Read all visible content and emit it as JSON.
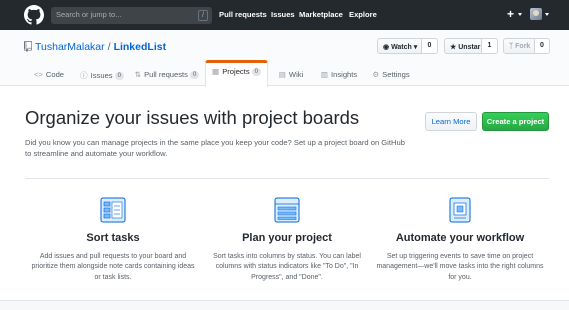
{
  "header": {
    "search_placeholder": "Search or jump to...",
    "search_key": "/",
    "nav": [
      "Pull requests",
      "Issues",
      "Marketplace",
      "Explore"
    ],
    "plus": "+"
  },
  "repo": {
    "owner": "TusharMalakar",
    "separator": "/",
    "name": "LinkedList",
    "watch_label": "Watch",
    "watch_count": "0",
    "unstar_label": "Unstar",
    "star_count": "1",
    "fork_label": "Fork",
    "fork_count": "0"
  },
  "tabs": [
    {
      "label": "Code",
      "icon": "<>",
      "count": null
    },
    {
      "label": "Issues",
      "icon": "ⓘ",
      "count": "0"
    },
    {
      "label": "Pull requests",
      "icon": "⇅",
      "count": "0"
    },
    {
      "label": "Projects",
      "icon": "▦",
      "count": "0",
      "selected": true
    },
    {
      "label": "Wiki",
      "icon": "▤",
      "count": null
    },
    {
      "label": "Insights",
      "icon": "▥",
      "count": null
    },
    {
      "label": "Settings",
      "icon": "⚙",
      "count": null
    }
  ],
  "blankslate": {
    "title": "Organize your issues with project boards",
    "description": "Did you know you can manage projects in the same place you keep your code? Set up a project board on GitHub to streamline and automate your workflow.",
    "learn_more": "Learn More",
    "create_project": "Create a project"
  },
  "features": [
    {
      "title": "Sort tasks",
      "icon": "sort-tasks-icon",
      "description": "Add issues and pull requests to your board and prioritize them alongside note cards containing ideas or task lists."
    },
    {
      "title": "Plan your project",
      "icon": "plan-project-icon",
      "description": "Sort tasks into columns by status. You can label columns with status indicators like \"To Do\", \"In Progress\", and \"Done\"."
    },
    {
      "title": "Automate your workflow",
      "icon": "automate-workflow-icon",
      "description": "Set up triggering events to save time on project management—we'll move tasks into the right columns for you."
    }
  ],
  "colors": {
    "header_bg": "#24292e",
    "link": "#0366d6",
    "selected_tab_accent": "#e36209",
    "primary_button": "#28a745",
    "icon_blue": "#2188ff"
  }
}
